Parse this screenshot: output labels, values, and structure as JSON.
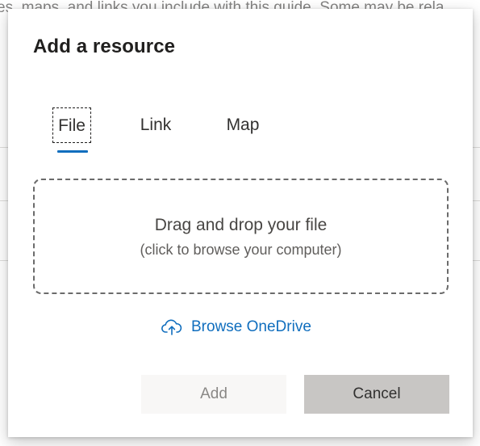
{
  "background": {
    "text": "es, maps, and links you include with this guide. Some may be rela"
  },
  "dialog": {
    "title": "Add a resource",
    "tabs": [
      {
        "label": "File",
        "selected": true
      },
      {
        "label": "Link",
        "selected": false
      },
      {
        "label": "Map",
        "selected": false
      }
    ],
    "dropzone": {
      "main_text": "Drag and drop your file",
      "sub_text": "(click to browse your computer)"
    },
    "onedrive": {
      "icon": "cloud-upload-icon",
      "label": "Browse OneDrive"
    },
    "buttons": {
      "add_label": "Add",
      "cancel_label": "Cancel"
    }
  },
  "colors": {
    "accent": "#106ebe",
    "cancel_bg": "#c8c6c4",
    "add_bg": "#f8f7f6"
  }
}
